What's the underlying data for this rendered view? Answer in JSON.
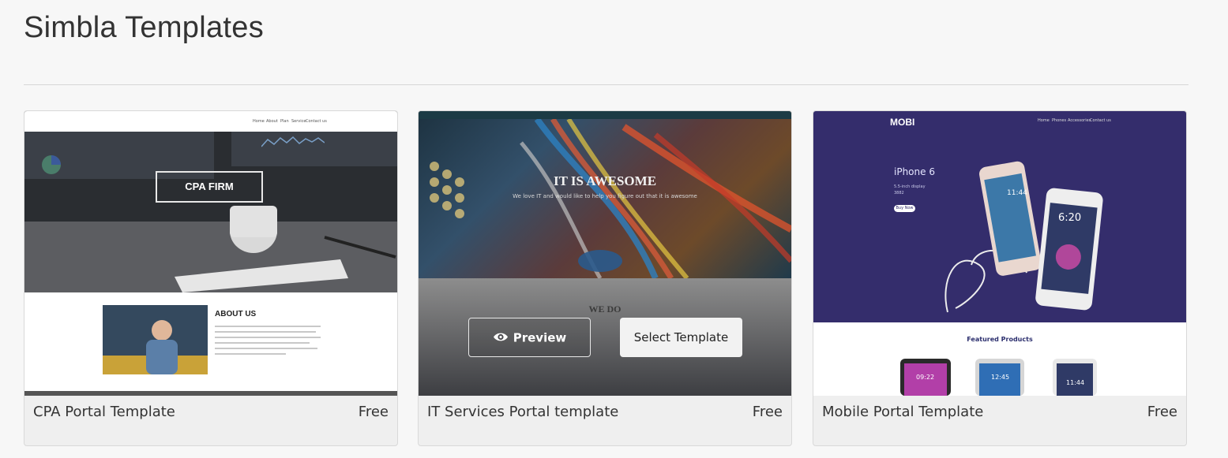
{
  "page": {
    "title": "Simbla Templates"
  },
  "templates": [
    {
      "name": "CPA Portal Template",
      "price": "Free",
      "preview": {
        "nav": [
          "Home",
          "About",
          "Plan",
          "Service",
          "Contact us"
        ],
        "hero": "CPA FIRM",
        "section": "ABOUT US"
      }
    },
    {
      "name": "IT Services Portal template",
      "price": "Free",
      "hovered": true,
      "preview": {
        "hero": "IT IS AWESOME",
        "tagline": "We love IT and would like to help you figure out that it is awesome",
        "section": "WE DO"
      },
      "actions": {
        "preview_label": "Preview",
        "select_label": "Select Template"
      }
    },
    {
      "name": "Mobile Portal Template",
      "price": "Free",
      "preview": {
        "logo": "MOBI",
        "nav": [
          "Home",
          "Phones",
          "Accessories",
          "Contact us"
        ],
        "product": "iPhone 6",
        "product_sub": [
          "5.5-inch display",
          "3882"
        ],
        "buy": "Buy Now",
        "times": [
          "11:44",
          "6:20",
          "09:22",
          "12:45",
          "11:44"
        ],
        "section": "Featured Products"
      }
    }
  ],
  "colors": {
    "mobi_bg": "#342d6c",
    "page_bg": "#f7f7f7"
  }
}
